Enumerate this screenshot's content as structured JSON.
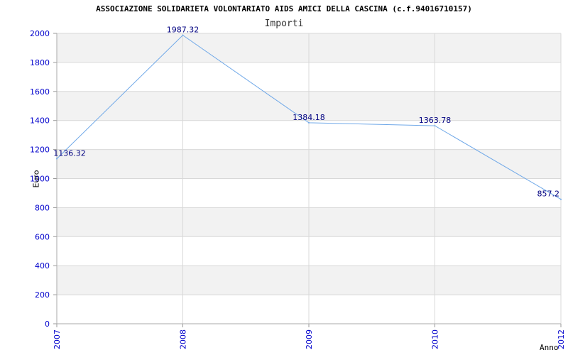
{
  "title": "ASSOCIAZIONE SOLIDARIETA VOLONTARIATO AIDS AMICI DELLA CASCINA (c.f.94016710157)",
  "subtitle": "Importi",
  "colors": {
    "line": "#6fa8e8",
    "label": "#000080",
    "tick": "#0000cc",
    "band": "#f2f2f2",
    "grid": "#d8d8d8"
  },
  "chart_data": {
    "type": "line",
    "title": "ASSOCIAZIONE SOLIDARIETA VOLONTARIATO AIDS AMICI DELLA CASCINA (c.f.94016710157)",
    "subtitle": "Importi",
    "xlabel": "Anno",
    "ylabel": "Euro",
    "categories": [
      "2007",
      "2008",
      "2009",
      "2010",
      "2012"
    ],
    "series": [
      {
        "values": [
          1136.32,
          1987.32,
          1384.18,
          1363.78,
          857.2
        ]
      }
    ],
    "data_labels": [
      "1136.32",
      "1987.32",
      "1384.18",
      "1363.78",
      "857.2"
    ],
    "yticks": [
      "0",
      "200",
      "400",
      "600",
      "800",
      "1000",
      "1200",
      "1400",
      "1600",
      "1800",
      "2000"
    ],
    "ylim": [
      0,
      2000
    ],
    "grid": true,
    "legend": "none"
  }
}
